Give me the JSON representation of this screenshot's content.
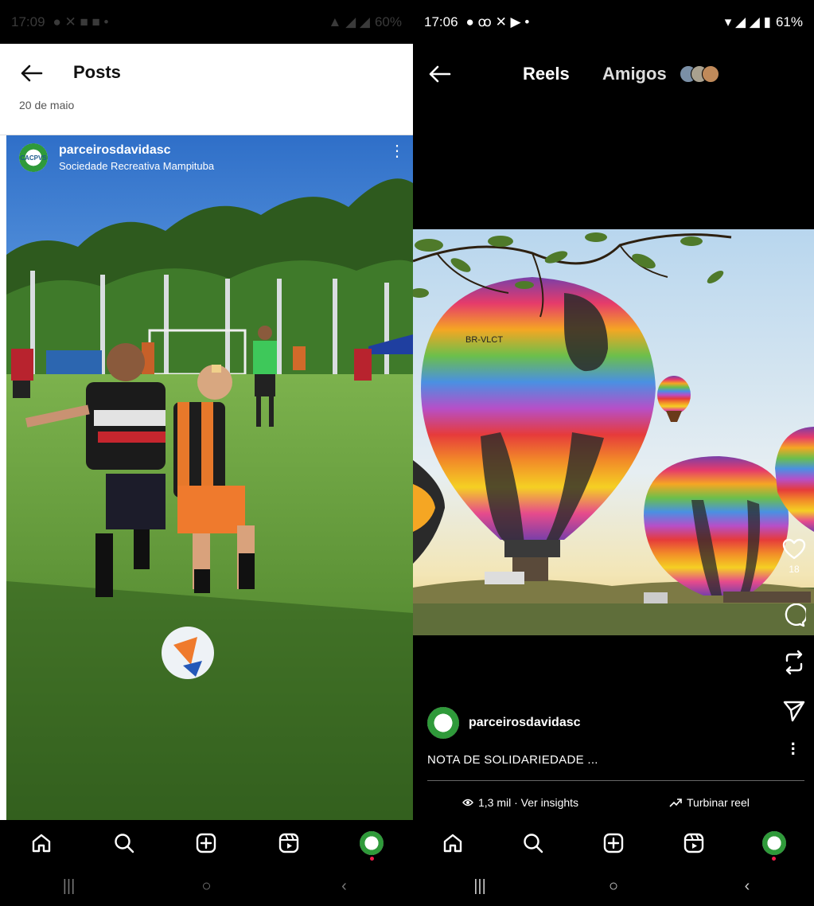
{
  "left": {
    "status": {
      "time": "17:09",
      "battery": "60%"
    },
    "header": {
      "title": "Posts",
      "date": "20 de maio"
    },
    "post": {
      "username": "parceirosdavidasc",
      "location": "Sociedade Recreativa Mampituba",
      "avatar_text": "CACPVS"
    }
  },
  "right": {
    "status": {
      "time": "17:06",
      "battery": "61%"
    },
    "header": {
      "tab_reels": "Reels",
      "tab_friends": "Amigos"
    },
    "reel": {
      "balloon_text": "BR-VLCT",
      "likes": "18",
      "username": "parceirosdavidasc",
      "caption": "NOTA DE SOLIDARIEDADE ...",
      "views": "1,3 mil · Ver insights",
      "boost": "Turbinar reel"
    }
  },
  "nav_icons": [
    "home-icon",
    "search-icon",
    "create-icon",
    "reels-icon",
    "profile-avatar"
  ],
  "colors": {
    "accent_red": "#ed1c4a",
    "grass": "#5e9a3a",
    "sky": "#3e7fd0"
  }
}
